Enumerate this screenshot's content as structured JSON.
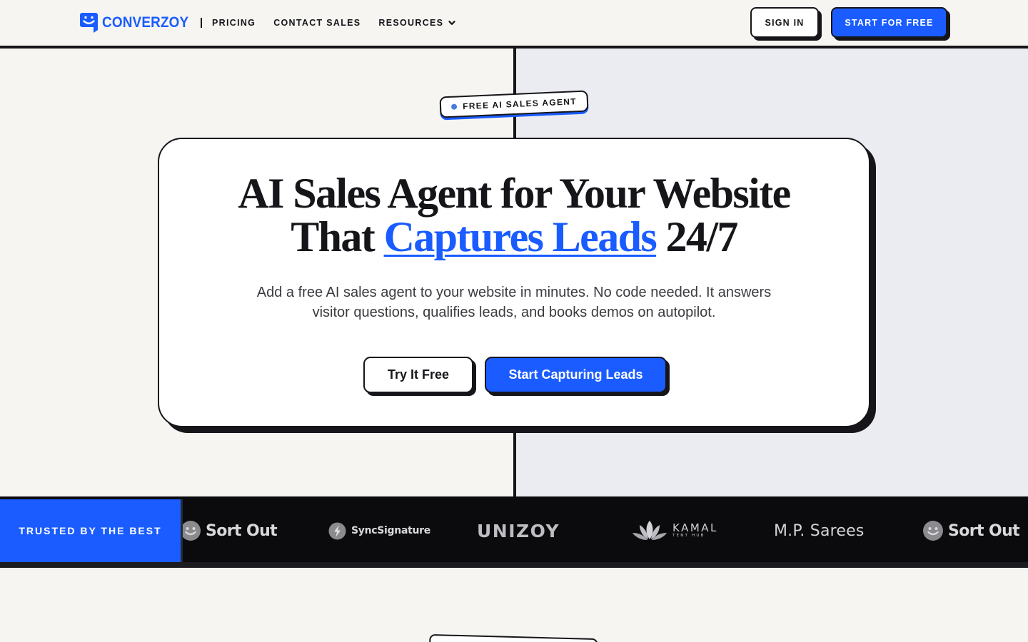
{
  "nav": {
    "brand": "CONVERZOY",
    "links": [
      {
        "label": "PRICING"
      },
      {
        "label": "CONTACT SALES"
      },
      {
        "label": "RESOURCES"
      }
    ],
    "signin_label": "SIGN IN",
    "start_label": "START FOR FREE"
  },
  "hero": {
    "badge": "FREE AI SALES AGENT",
    "title_line1": "AI Sales Agent for Your Website",
    "title_line2_prefix": "That",
    "title_highlight": "Captures Leads",
    "title_line2_suffix": "24/7",
    "subtitle": "Add a free AI sales agent to your website in minutes. No code needed. It answers visitor questions, qualifies leads, and books demos on autopilot.",
    "cta_secondary": "Try It Free",
    "cta_primary": "Start Capturing Leads"
  },
  "trusted": {
    "label": "TRUSTED BY THE BEST",
    "logos": [
      {
        "name": "Sort Out",
        "icon": "smiley-face-icon"
      },
      {
        "name": "SyncSignature",
        "icon": "lightning-bolt-icon"
      },
      {
        "name": "UNIZOY",
        "icon": ""
      },
      {
        "name": "KAMAL",
        "tagline": "TENT HUB",
        "icon": "lotus-icon"
      },
      {
        "name": "M.P. Sarees",
        "icon": ""
      },
      {
        "name": "Sort Out",
        "icon": "smiley-face-icon"
      }
    ]
  },
  "colors": {
    "accent": "#1a5cff",
    "ink": "#16161a",
    "background": "#f6f5f2",
    "hero_right": "#ebecf1",
    "strip": "#0b0b0e"
  }
}
